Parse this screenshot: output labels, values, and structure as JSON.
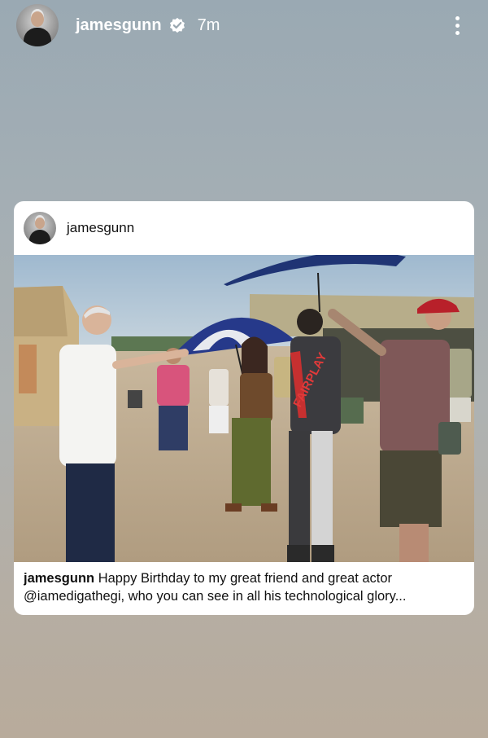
{
  "story": {
    "username": "jamesgunn",
    "time": "7m",
    "verified_icon": "verified-badge-icon",
    "more_icon": "more-vertical-icon"
  },
  "post": {
    "username": "jamesgunn",
    "photo": {
      "jacket_text": "FAIRPLAY"
    },
    "caption": {
      "user": "jamesgunn",
      "line1_rest": " Happy Birthday to my great friend and great actor",
      "line2": "@iamedigathegi, who you can see in all his technological glory..."
    }
  },
  "colors": {
    "username_text": "#ffffff",
    "card_background": "#ffffff",
    "caption_text": "#111111"
  }
}
